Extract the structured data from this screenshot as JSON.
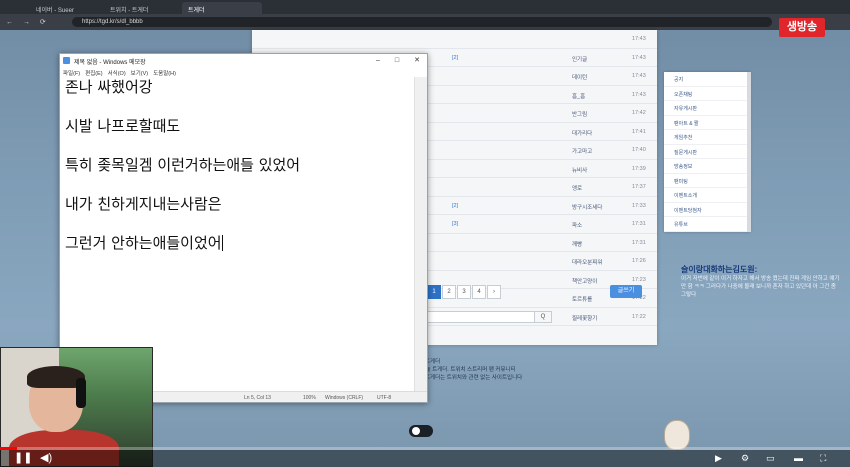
{
  "browser": {
    "tabs": [
      "네이버 - Sueer",
      "트위치 - 트게더",
      "트게더"
    ],
    "url": "https://tgd.kr/s/dl_bbbb"
  },
  "live_badge": "생방송",
  "board": {
    "rows": [
      {
        "author": "",
        "time": "17:43"
      },
      {
        "author": "인기글",
        "time": "17:43"
      },
      {
        "author": "데이턴",
        "time": "17:43"
      },
      {
        "author": "흠_흠",
        "time": "17:43"
      },
      {
        "author": "반그림",
        "time": "17:42"
      },
      {
        "author": "대가리다",
        "time": "17:41"
      },
      {
        "author": "가고마고",
        "time": "17:40"
      },
      {
        "author": "뉴비사",
        "time": "17:39"
      },
      {
        "author": "앵로",
        "time": "17:37"
      },
      {
        "author": "방구시조세다",
        "time": "17:33"
      },
      {
        "author": "파소",
        "time": "17:31"
      },
      {
        "author": "깨빵",
        "time": "17:31"
      },
      {
        "author": "대라오분찌워",
        "time": "17:26"
      },
      {
        "author": "책안고양이",
        "time": "17:23"
      },
      {
        "author": "토르튜를",
        "time": "17:22"
      },
      {
        "author": "찔레꽃향기",
        "time": "17:22"
      }
    ],
    "comments": [
      "[2]",
      "[3]",
      "[2]"
    ],
    "pages": [
      "1",
      "2",
      "3",
      "4"
    ],
    "write_label": "글쓰기",
    "search_label": "Q"
  },
  "side_menu": {
    "items": [
      "공지",
      "오픈채팅",
      "자유게시판",
      "팬아트 & 짤",
      "게임추천",
      "질문게시판",
      "방송정보",
      "팬미팅",
      "이벤트소개",
      "이벤트당첨자",
      "유튜브"
    ]
  },
  "chat": {
    "name": "슬이랑대화하는김도원:",
    "message": "이거 저번에 같이 이거 하자고 해서 방송 켰는데 진짜 게임 안하고 얘기만 함 ㅋㅋ 그러다가 나중에 몰래 보니까 혼자 하고 있던데 아 그건 좀 그렇다"
  },
  "notepad": {
    "title": "제목 없음 - Windows 메모장",
    "menus": [
      "파일(F)",
      "편집(E)",
      "서식(O)",
      "보기(V)",
      "도움말(H)"
    ],
    "lines": [
      "존나 싸했어강",
      "시발 나프로할때도",
      "특히 좆목일겜 이런거하는애들 있었어",
      "내가 친하게지내는사람은",
      "그런거 안하는애들이었어"
    ],
    "status": {
      "position": "Ln 5, Col 13",
      "zoom": "100%",
      "eol": "Windows (CRLF)",
      "encoding": "UTF-8"
    }
  },
  "lower_text": [
    "트게더",
    "@ 트게더. 트위치 스트리머 팬 커뮤니티",
    "트게더는 트위치와 관련 없는 사이트입니다"
  ],
  "player": {
    "progress": 0.02
  },
  "colors": {
    "live": "#e0262b",
    "accent": "#2d71c7",
    "progress": "#ff0000"
  }
}
